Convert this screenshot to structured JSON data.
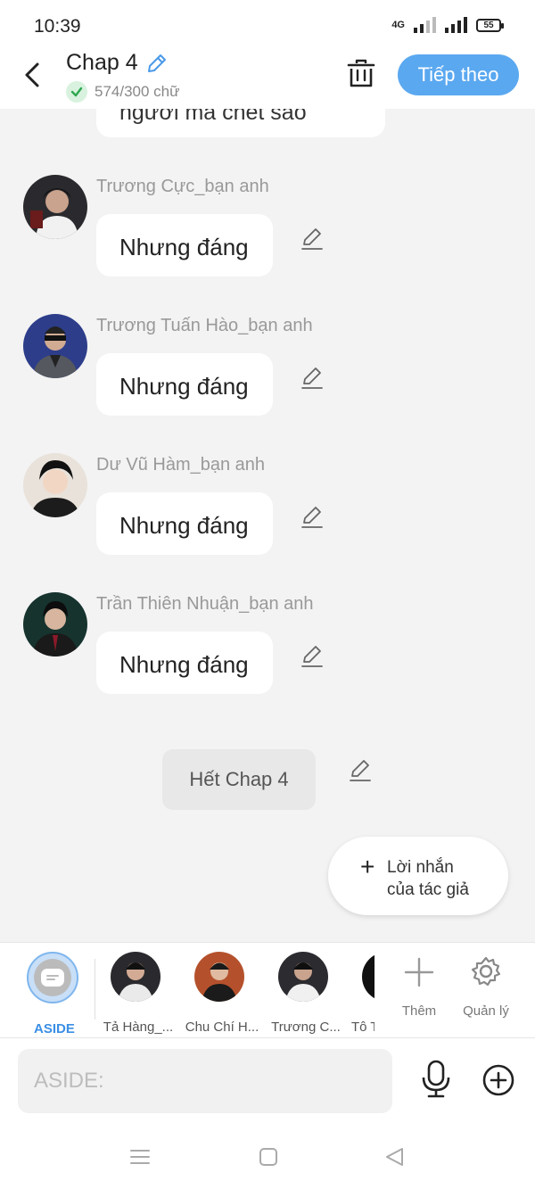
{
  "status_bar": {
    "time": "10:39",
    "network": "4G",
    "battery": "55"
  },
  "header": {
    "title": "Chap 4",
    "word_count": "574/300 chữ",
    "next_label": "Tiếp theo"
  },
  "chat": {
    "previous_bubble_text": "người mà chết sao",
    "messages": [
      {
        "sender": "Trương Cực_bạn anh",
        "text": "Nhưng đáng"
      },
      {
        "sender": "Trương Tuấn Hào_bạn anh",
        "text": "Nhưng đáng"
      },
      {
        "sender": "Dư Vũ Hàm_bạn anh",
        "text": "Nhưng đáng"
      },
      {
        "sender": "Trần Thiên Nhuận_bạn anh",
        "text": "Nhưng đáng"
      }
    ],
    "end_label": "Hết Chap 4",
    "author_note": {
      "line1": "Lời nhắn",
      "line2": "của tác giả"
    }
  },
  "characters": {
    "aside_label": "ASIDE",
    "items": [
      {
        "label": "Tả Hàng_..."
      },
      {
        "label": "Chu Chí H..."
      },
      {
        "label": "Trương C..."
      },
      {
        "label": "Tô T"
      }
    ],
    "add_label": "Thêm",
    "manage_label": "Quản lý"
  },
  "input": {
    "placeholder": "ASIDE:"
  },
  "colors": {
    "accent": "#5aa8f0",
    "background": "#f3f3f3",
    "bubble": "#ffffff"
  }
}
